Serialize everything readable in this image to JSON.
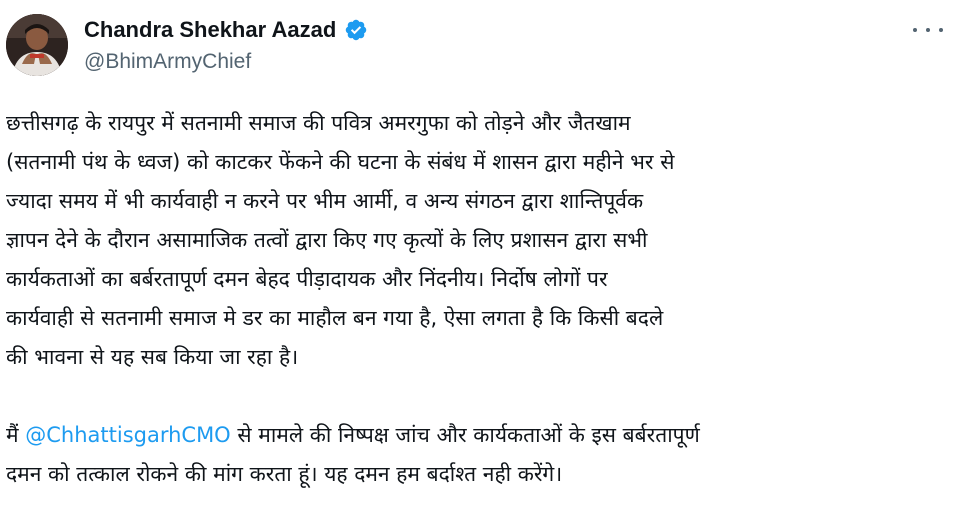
{
  "author": {
    "display_name": "Chandra Shekhar Aazad",
    "handle": "@BhimArmyChief",
    "avatar_icon": "profile-photo",
    "verified_icon": "verified-badge-icon",
    "verified_color": "#1d9bf0"
  },
  "menu": {
    "more_icon": "more-horizontal-icon"
  },
  "tweet": {
    "para1_lines": [
      "छत्तीसगढ़ के रायपुर में सतनामी समाज की पवित्र अमरगुफा को तोड़ने और जैतखाम",
      "(सतनामी पंथ के ध्वज) को काटकर फेंकने की घटना के संबंध में शासन द्वारा महीने भर से",
      "ज्यादा समय में भी कार्यवाही न करने पर भीम आर्मी, व अन्य संगठन द्वारा शान्तिपूर्वक",
      "ज्ञापन देने के दौरान असामाजिक तत्वों द्वारा किए गए कृत्यों के लिए प्रशासन द्वारा सभी",
      "कार्यकताओं का बर्बरतापूर्ण दमन बेहद पीड़ादायक और निंदनीय। निर्दोष लोगों पर",
      "कार्यवाही से सतनामी समाज मे डर का माहौल बन गया है, ऐसा लगता है कि किसी बदले",
      "की भावना से यह सब किया जा रहा है।"
    ],
    "para2_line1_prefix": "मैं ",
    "mention": "@ChhattisgarhCMO",
    "para2_line1_suffix": " से मामले की निष्पक्ष जांच और कार्यकताओं के इस बर्बरतापूर्ण",
    "para2_line2": "दमन को तत्काल रोकने की मांग करता हूं। यह दमन हम बर्दाश्त नही करेंगे।",
    "mention_color": "#1d9bf0"
  }
}
